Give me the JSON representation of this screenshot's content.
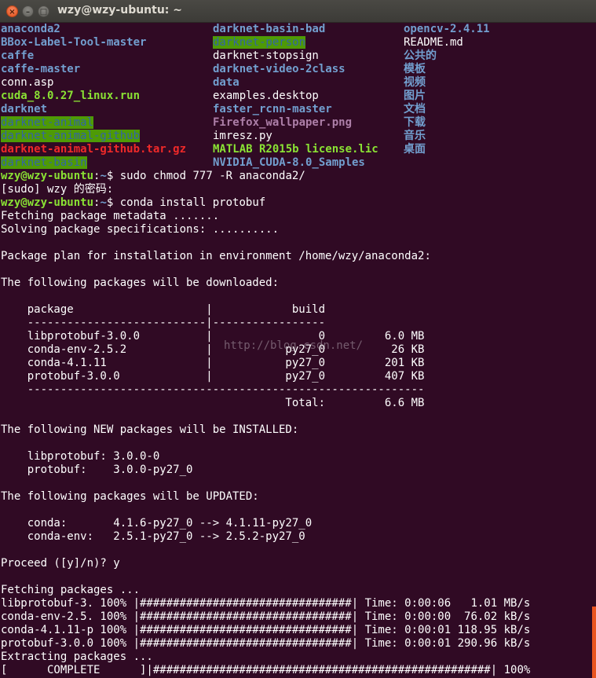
{
  "window": {
    "title": "wzy@wzy-ubuntu: ~",
    "close_glyph": "×",
    "min_glyph": "–",
    "max_glyph": "□"
  },
  "ls": {
    "col1": [
      {
        "text": "anaconda2",
        "type": "dir"
      },
      {
        "text": "BBox-Label-Tool-master",
        "type": "dir"
      },
      {
        "text": "caffe",
        "type": "dir"
      },
      {
        "text": "caffe-master",
        "type": "dir"
      },
      {
        "text": "conn.asp",
        "type": "file"
      },
      {
        "text": "cuda_8.0.27_linux.run",
        "type": "exe"
      },
      {
        "text": "darknet",
        "type": "dir"
      },
      {
        "text": "darknet-animal",
        "type": "hl"
      },
      {
        "text": "darknet-animal-github",
        "type": "hl"
      },
      {
        "text": "darknet-animal-github.tar.gz",
        "type": "arc"
      },
      {
        "text": "darknet-basin",
        "type": "hl"
      }
    ],
    "col2": [
      {
        "text": "darknet-basin-bad",
        "type": "dir"
      },
      {
        "text": "darknet-person",
        "type": "hl"
      },
      {
        "text": "darknet-stopsign",
        "type": "file"
      },
      {
        "text": "darknet-video-2class",
        "type": "dir"
      },
      {
        "text": "data",
        "type": "dir"
      },
      {
        "text": "examples.desktop",
        "type": "file"
      },
      {
        "text": "faster_rcnn-master",
        "type": "dir"
      },
      {
        "text": "Firefox_wallpaper.png",
        "type": "img"
      },
      {
        "text": "imresz.py",
        "type": "file"
      },
      {
        "text": "MATLAB R2015b license.lic",
        "type": "exe"
      },
      {
        "text": "NVIDIA_CUDA-8.0_Samples",
        "type": "dir"
      }
    ],
    "col3": [
      {
        "text": "opencv-2.4.11",
        "type": "dir"
      },
      {
        "text": "README.md",
        "type": "file"
      },
      {
        "text": "公共的",
        "type": "dir"
      },
      {
        "text": "模板",
        "type": "dir"
      },
      {
        "text": "视频",
        "type": "dir"
      },
      {
        "text": "图片",
        "type": "dir"
      },
      {
        "text": "文档",
        "type": "dir"
      },
      {
        "text": "下载",
        "type": "dir"
      },
      {
        "text": "音乐",
        "type": "dir"
      },
      {
        "text": "桌面",
        "type": "dir"
      }
    ]
  },
  "prompt": {
    "user_host": "wzy@wzy-ubuntu",
    "sep": ":",
    "path": "~",
    "symbol": "$ "
  },
  "commands": {
    "chmod": "sudo chmod 777 -R anaconda2/",
    "sudo_prompt": "[sudo] wzy 的密码:",
    "install": "conda install protobuf"
  },
  "output": {
    "fetching_meta": "Fetching package metadata .......",
    "solving": "Solving package specifications: ..........",
    "plan": "Package plan for installation in environment /home/wzy/anaconda2:",
    "will_download": "The following packages will be downloaded:",
    "table_header": "    package                    |            build",
    "table_sep": "    ---------------------------|-----------------",
    "table_rows": [
      "    libprotobuf-3.0.0          |                0         6.0 MB",
      "    conda-env-2.5.2            |           py27_0          26 KB",
      "    conda-4.1.11               |           py27_0         201 KB",
      "    protobuf-3.0.0             |           py27_0         407 KB"
    ],
    "table_footer_sep": "    ------------------------------------------------------------",
    "table_total": "                                           Total:         6.6 MB",
    "new_installed": "The following NEW packages will be INSTALLED:",
    "new_packages": [
      "    libprotobuf: 3.0.0-0",
      "    protobuf:    3.0.0-py27_0"
    ],
    "updated": "The following packages will be UPDATED:",
    "updated_packages": [
      "    conda:       4.1.6-py27_0 --> 4.1.11-py27_0",
      "    conda-env:   2.5.1-py27_0 --> 2.5.2-py27_0"
    ],
    "proceed": "Proceed ([y]/n)? y",
    "fetching_packages": "Fetching packages ...",
    "progress": [
      "libprotobuf-3. 100% |################################| Time: 0:00:06   1.01 MB/s",
      "conda-env-2.5. 100% |################################| Time: 0:00:00  76.02 kB/s",
      "conda-4.1.11-p 100% |################################| Time: 0:00:01 118.95 kB/s",
      "protobuf-3.0.0 100% |################################| Time: 0:00:01 290.96 kB/s"
    ],
    "extracting": "Extracting packages ...",
    "complete": "[      COMPLETE      ]|###################################################| 100%"
  },
  "watermark": "http://blog.csdn.net/",
  "colors": {
    "background": "#300a24",
    "dir": "#729fcf",
    "exe": "#8ae234",
    "archive": "#ef2929",
    "image": "#ad7fa8",
    "highlight_bg": "#4e9a06",
    "scrollbar": "#e95420"
  }
}
